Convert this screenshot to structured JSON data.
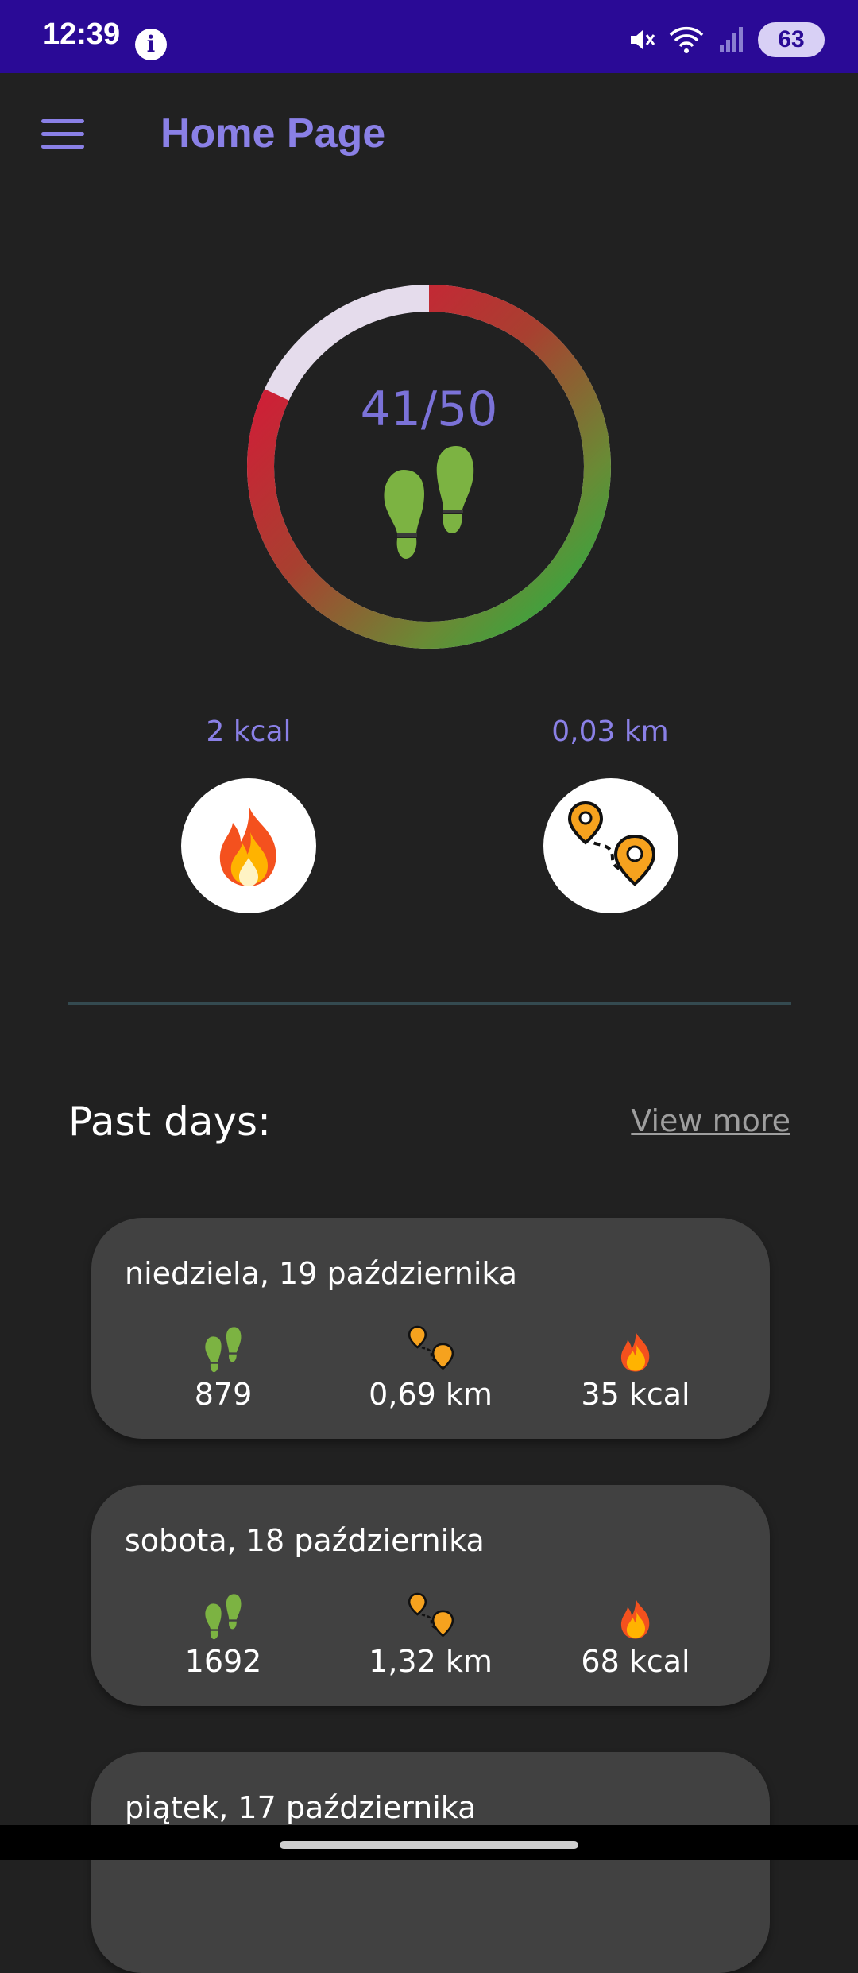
{
  "status_bar": {
    "time": "12:39",
    "info_glyph": "i",
    "icons": [
      "mute-icon",
      "wifi-icon",
      "signal-icon"
    ],
    "battery": "63"
  },
  "app_bar": {
    "title": "Home Page",
    "menu_icon": "hamburger-icon"
  },
  "daily_goal": {
    "value_text": "41/50",
    "progress": 0.82,
    "icon": "footsteps-icon"
  },
  "stats": {
    "calories": {
      "label": "2 kcal",
      "icon": "fire-icon"
    },
    "distance": {
      "label": "0,03 km",
      "icon": "route-icon"
    }
  },
  "past_days": {
    "title": "Past days:",
    "view_more": "View more",
    "days": [
      {
        "date": "niedziela, 19 października",
        "steps": "879",
        "distance": "0,69 km",
        "calories": "35 kcal"
      },
      {
        "date": "sobota, 18 października",
        "steps": "1692",
        "distance": "1,32 km",
        "calories": "68 kcal"
      },
      {
        "date": "piątek, 17 października",
        "steps": "",
        "distance": "",
        "calories": ""
      }
    ]
  },
  "colors": {
    "status_bar": "#2a0a96",
    "accent": "#8a80e6",
    "background": "#212121",
    "card": "#414141",
    "ring_start": "#e0103a",
    "ring_end": "#22b243",
    "ring_track": "#e5dcec"
  }
}
